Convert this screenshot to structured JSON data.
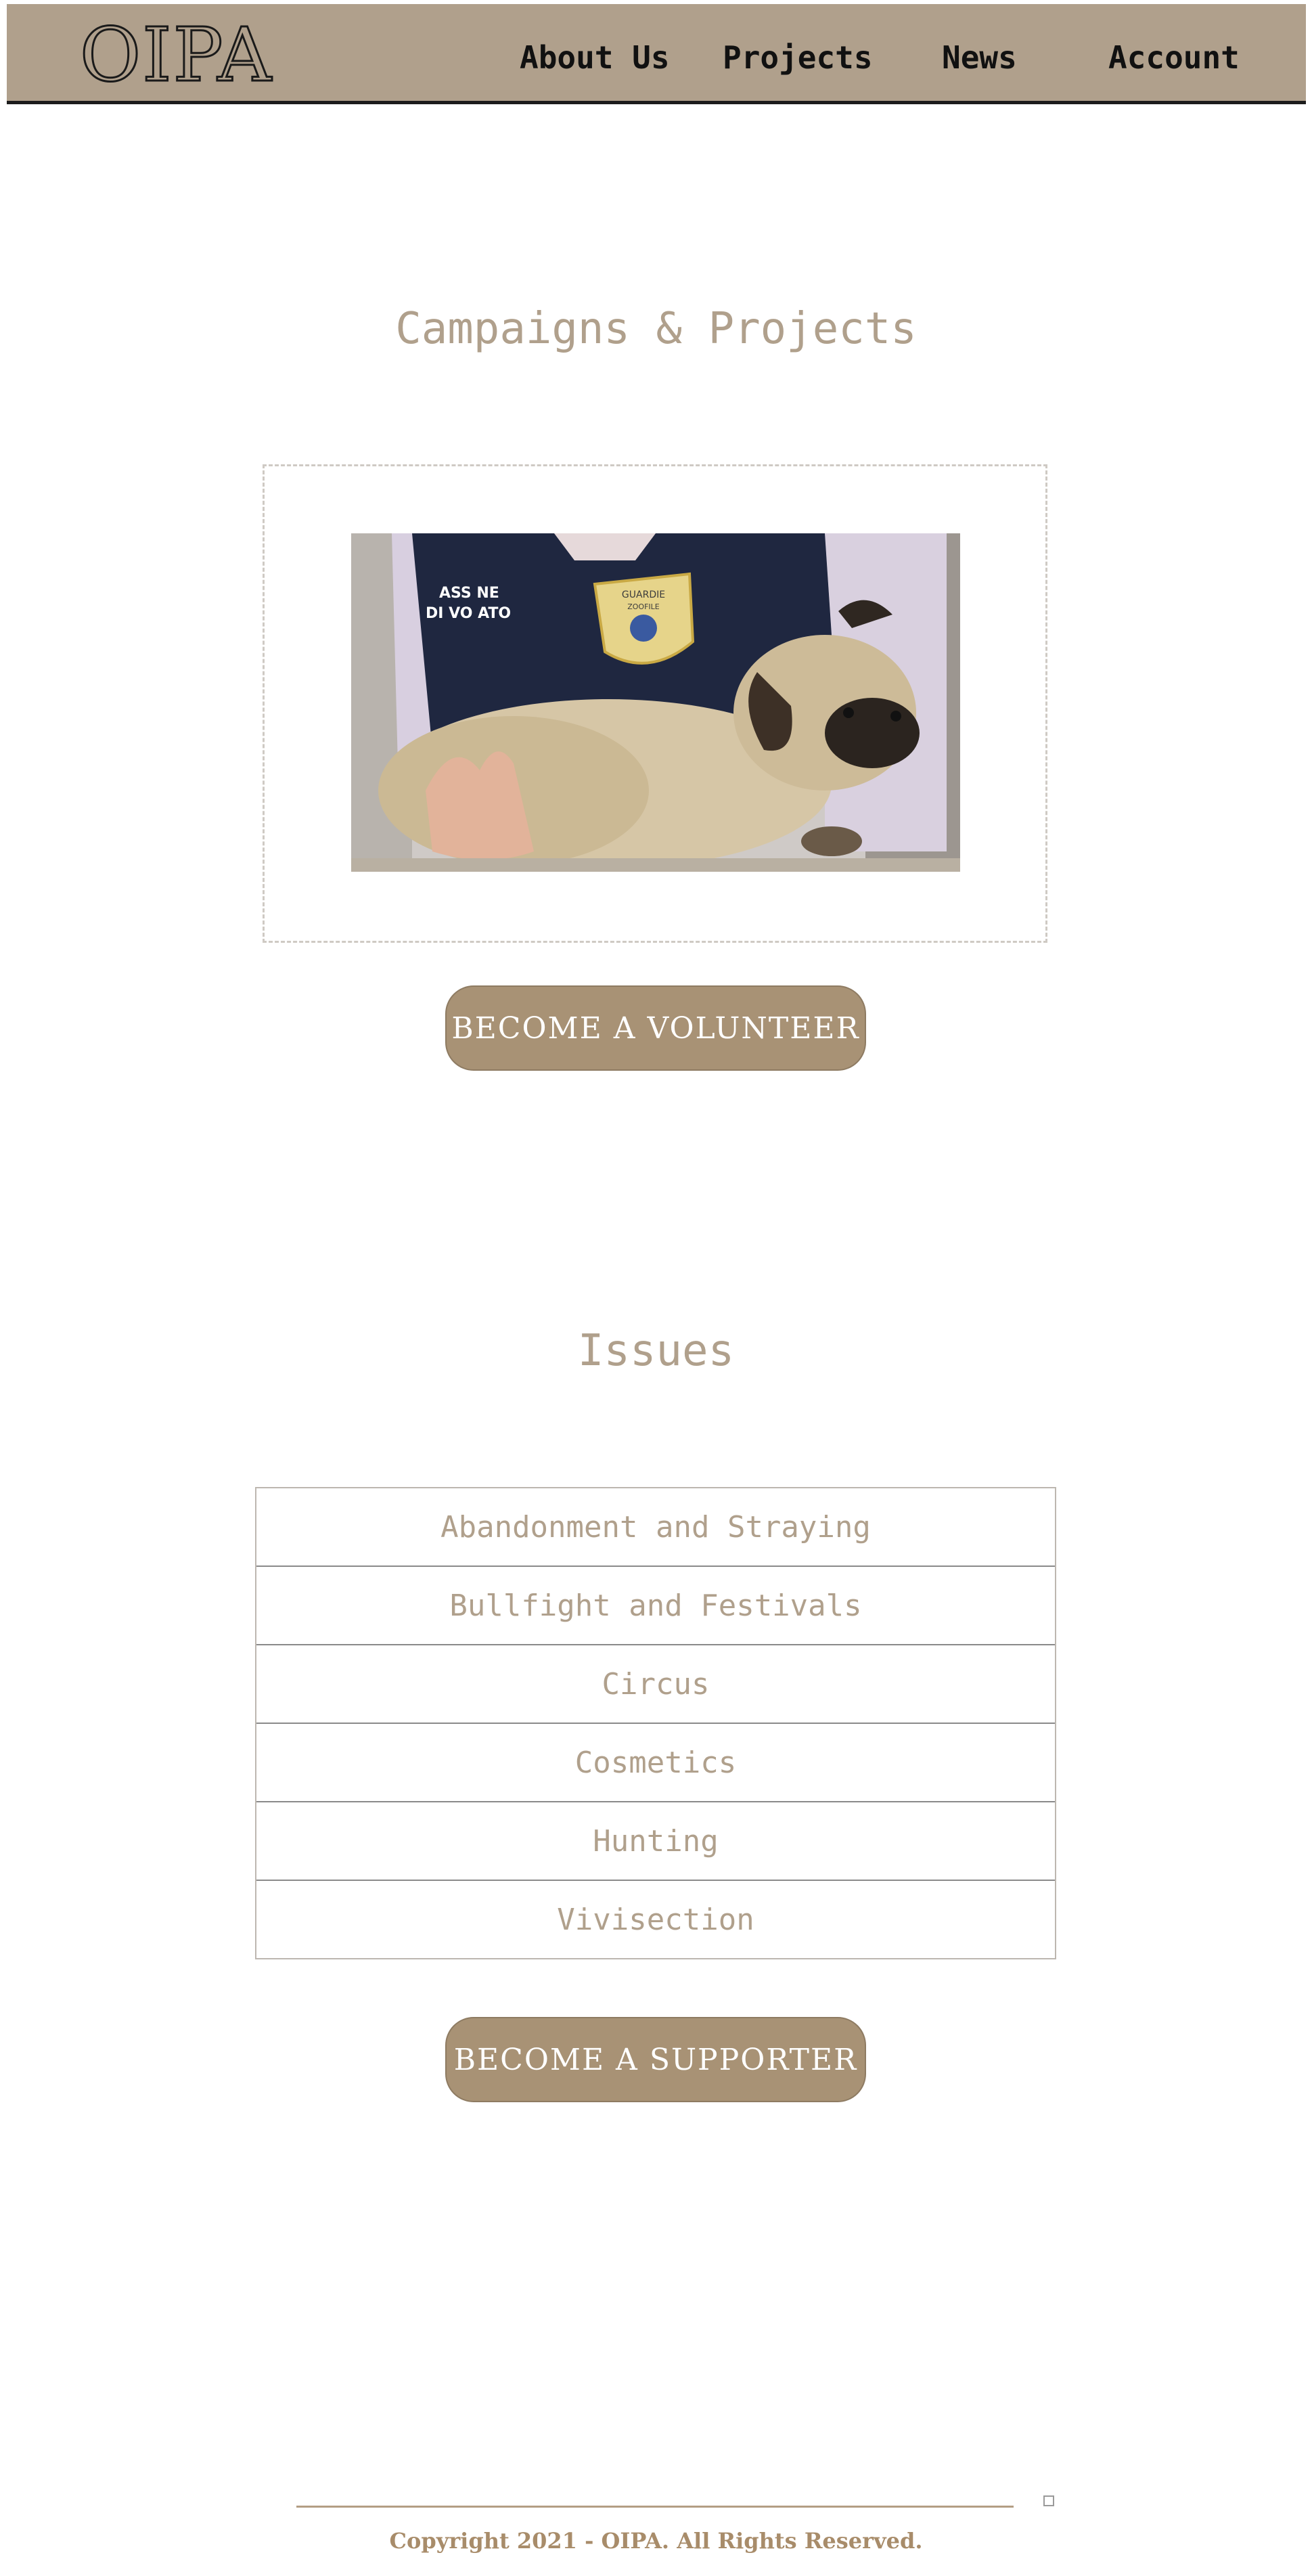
{
  "header": {
    "logo": "OIPA",
    "nav": [
      "About Us",
      "Projects",
      "News",
      "Account"
    ]
  },
  "campaigns": {
    "title": "Campaigns & Projects",
    "image_alt": "Volunteer guard holding a pug",
    "badge_text_1": "GUARDIE",
    "badge_text_2": "ZOOFILE",
    "vest_text_1": "ASS   NE",
    "vest_text_2": "DI VO   ATO",
    "cta": "BECOME A VOLUNTEER"
  },
  "issues": {
    "title": "Issues",
    "items": [
      "Abandonment and Straying",
      "Bullfight and Festivals",
      "Circus",
      "Cosmetics",
      "Hunting",
      "Vivisection"
    ],
    "cta": "BECOME A SUPPORTER"
  },
  "footer": {
    "copyright": "Copyright 2021 - OIPA. All Rights Reserved."
  },
  "colors": {
    "header_bg": "#b0a08c",
    "accent": "#a89275",
    "title_text": "#b0a08c",
    "footer_text": "#a88c6a"
  }
}
